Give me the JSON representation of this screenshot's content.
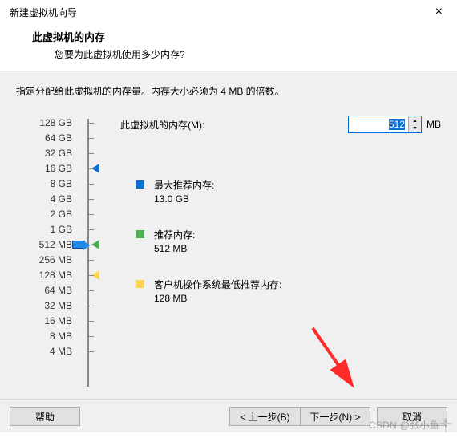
{
  "window": {
    "title": "新建虚拟机向导",
    "close_glyph": "×"
  },
  "header": {
    "title": "此虚拟机的内存",
    "subtitle": "您要为此虚拟机使用多少内存?"
  },
  "body": {
    "description": "指定分配给此虚拟机的内存量。内存大小必须为 4 MB 的倍数。",
    "mem_label": "此虚拟机的内存(M):",
    "mem_value": "512",
    "mem_unit": "MB",
    "scale": [
      "128 GB",
      "64 GB",
      "32 GB",
      "16 GB",
      "8 GB",
      "4 GB",
      "2 GB",
      "1 GB",
      "512 MB",
      "256 MB",
      "128 MB",
      "64 MB",
      "32 MB",
      "16 MB",
      "8 MB",
      "4 MB"
    ],
    "legend": {
      "max": {
        "label": "最大推荐内存:",
        "value": "13.0 GB",
        "color": "#0a6ed1"
      },
      "rec": {
        "label": "推荐内存:",
        "value": "512 MB",
        "color": "#4caf50"
      },
      "min": {
        "label": "客户机操作系统最低推荐内存:",
        "value": "128 MB",
        "color": "#ffd54f"
      }
    }
  },
  "footer": {
    "help": "帮助",
    "back": "< 上一步(B)",
    "next": "下一步(N) >",
    "cancel": "取消"
  },
  "watermark": "CSDN @张小鱼༒"
}
